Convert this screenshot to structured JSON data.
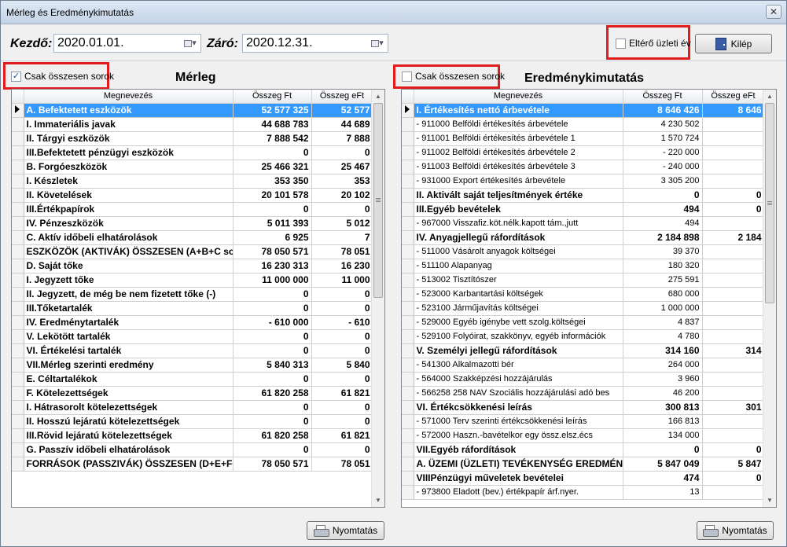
{
  "window": {
    "title": "Mérleg és Eredménykimutatás",
    "close_label": "✕"
  },
  "header": {
    "from_label": "Kezdő:",
    "from_value": "2020.01.01.",
    "to_label": "Záró:",
    "to_value": "2020.12.31.",
    "fiscal_year_label": "Eltérő üzleti év",
    "fiscal_year_checked": false,
    "exit_label": "Kilép"
  },
  "balance": {
    "title": "Mérleg",
    "only_totals_label": "Csak összesen sorok",
    "only_totals_checked": true,
    "columns": [
      "Megnevezés",
      "Összeg Ft",
      "Összeg eFt"
    ],
    "rows": [
      {
        "name": "A.  Befektetett eszközök",
        "ft": "52 577 325",
        "eft": "52 577",
        "selected": true
      },
      {
        "name": "I.   Immateriális javak",
        "ft": "44 688 783",
        "eft": "44 689"
      },
      {
        "name": "II.  Tárgyi eszközök",
        "ft": "7 888 542",
        "eft": "7 888"
      },
      {
        "name": "III.Befektetett pénzügyi eszközök",
        "ft": "0",
        "eft": "0"
      },
      {
        "name": "B.  Forgóeszközök",
        "ft": "25 466 321",
        "eft": "25 467"
      },
      {
        "name": "I.   Készletek",
        "ft": "353 350",
        "eft": "353"
      },
      {
        "name": "II.  Követelések",
        "ft": "20 101 578",
        "eft": "20 102"
      },
      {
        "name": "III.Értékpapírok",
        "ft": "0",
        "eft": "0"
      },
      {
        "name": "IV.  Pénzeszközök",
        "ft": "5 011 393",
        "eft": "5 012"
      },
      {
        "name": "C.  Aktív időbeli elhatárolások",
        "ft": "6 925",
        "eft": "7"
      },
      {
        "name": "ESZKÖZÖK (AKTIVÁK) ÖSSZESEN (A+B+C sor)",
        "ft": "78 050 571",
        "eft": "78 051"
      },
      {
        "name": "D.  Saját tőke",
        "ft": "16 230 313",
        "eft": "16 230"
      },
      {
        "name": "I.  Jegyzett tőke",
        "ft": "11 000 000",
        "eft": "11 000"
      },
      {
        "name": "II.  Jegyzett, de még be nem fizetett tőke (-)",
        "ft": "0",
        "eft": "0"
      },
      {
        "name": "III.Tőketartalék",
        "ft": "0",
        "eft": "0"
      },
      {
        "name": "IV.  Eredménytartalék",
        "ft": "-  610 000",
        "eft": "-    610"
      },
      {
        "name": "V.   Lekötött tartalék",
        "ft": "0",
        "eft": "0"
      },
      {
        "name": "VI.  Értékelési tartalék",
        "ft": "0",
        "eft": "0"
      },
      {
        "name": "VII.Mérleg szerinti eredmény",
        "ft": "5 840 313",
        "eft": "5 840"
      },
      {
        "name": "E.   Céltartalékok",
        "ft": "0",
        "eft": "0"
      },
      {
        "name": "F.   Kötelezettségek",
        "ft": "61 820 258",
        "eft": "61 821"
      },
      {
        "name": "I.  Hátrasorolt kötelezettségek",
        "ft": "0",
        "eft": "0"
      },
      {
        "name": "II.  Hosszú lejáratú kötelezettségek",
        "ft": "0",
        "eft": "0"
      },
      {
        "name": "III.Rövid lejáratú kötelezettségek",
        "ft": "61 820 258",
        "eft": "61 821"
      },
      {
        "name": "G.  Passzív időbeli elhatárolások",
        "ft": "0",
        "eft": "0"
      },
      {
        "name": "FORRÁSOK (PASSZIVÁK) ÖSSZESEN (D+E+F+G)",
        "ft": "78 050 571",
        "eft": "78 051"
      }
    ],
    "print_label": "Nyomtatás"
  },
  "income": {
    "title": "Eredménykimutatás",
    "only_totals_label": "Csak összesen sorok",
    "only_totals_checked": false,
    "columns": [
      "Megnevezés",
      "Összeg Ft",
      "Összeg eFt"
    ],
    "rows": [
      {
        "name": "I.  Értékesítés nettó árbevétele",
        "ft": "8 646 426",
        "eft": "8 646",
        "bold": true,
        "selected": true
      },
      {
        "name": "- 911000 Belföldi értékesítés árbevétele",
        "ft": "4 230 502",
        "eft": ""
      },
      {
        "name": "- 911001 Belföldi értékesítés árbevétele 1",
        "ft": "1 570 724",
        "eft": ""
      },
      {
        "name": "- 911002 Belföldi értékesítés árbevétele 2",
        "ft": "-  220 000",
        "eft": ""
      },
      {
        "name": "- 911003 Belföldi értékesítés árbevétele 3",
        "ft": "-  240 000",
        "eft": ""
      },
      {
        "name": "- 931000 Export értékesítés árbevétele",
        "ft": "3 305 200",
        "eft": ""
      },
      {
        "name": "II. Aktivált saját teljesítmények értéke",
        "ft": "0",
        "eft": "0",
        "bold": true
      },
      {
        "name": "III.Egyéb bevételek",
        "ft": "494",
        "eft": "0",
        "bold": true
      },
      {
        "name": "- 967000 Visszafiz.köt.nélk.kapott tám.,jutt",
        "ft": "494",
        "eft": ""
      },
      {
        "name": "IV. Anyagjellegű ráfordítások",
        "ft": "2 184 898",
        "eft": "2 184",
        "bold": true
      },
      {
        "name": "- 511000 Vásárolt anyagok költségei",
        "ft": "39 370",
        "eft": ""
      },
      {
        "name": "- 511100 Alapanyag",
        "ft": "180 320",
        "eft": ""
      },
      {
        "name": "- 513002 Tisztítószer",
        "ft": "275 591",
        "eft": ""
      },
      {
        "name": "- 523000 Karbantartási költségek",
        "ft": "680 000",
        "eft": ""
      },
      {
        "name": "- 523100 Járműjavítás költségei",
        "ft": "1 000 000",
        "eft": ""
      },
      {
        "name": "- 529000 Egyéb igénybe vett szolg.költségei",
        "ft": "4 837",
        "eft": ""
      },
      {
        "name": "- 529100 Folyóirat, szakkönyv, egyéb információk",
        "ft": "4 780",
        "eft": ""
      },
      {
        "name": "V.   Személyi jellegű ráfordítások",
        "ft": "314 160",
        "eft": "314",
        "bold": true
      },
      {
        "name": "- 541300 Alkalmazotti bér",
        "ft": "264 000",
        "eft": ""
      },
      {
        "name": "- 564000 Szakképzési hozzájárulás",
        "ft": "3 960",
        "eft": ""
      },
      {
        "name": "- 566258 258 NAV Szociális hozzájárulási adó bes",
        "ft": "46 200",
        "eft": ""
      },
      {
        "name": "VI. Értékcsökkenési leírás",
        "ft": "300 813",
        "eft": "301",
        "bold": true
      },
      {
        "name": "- 571000 Terv szerinti értékcsökkenési leírás",
        "ft": "166 813",
        "eft": ""
      },
      {
        "name": "- 572000 Haszn.-bavételkor egy össz.elsz.écs",
        "ft": "134 000",
        "eft": ""
      },
      {
        "name": "VII.Egyéb ráfordítások",
        "ft": "0",
        "eft": "0",
        "bold": true
      },
      {
        "name": "A.  ÜZEMI (ÜZLETI) TEVÉKENYSÉG EREDMÉNYE",
        "ft": "5 847 049",
        "eft": "5 847",
        "bold": true
      },
      {
        "name": "VIIIPénzügyi műveletek bevételei",
        "ft": "474",
        "eft": "0",
        "bold": true
      },
      {
        "name": "- 973800 Eladott (bev.) értékpapír árf.nyer.",
        "ft": "13",
        "eft": ""
      }
    ],
    "print_label": "Nyomtatás"
  },
  "icons": {
    "calendar": "calendar-icon",
    "dropdown": "▾",
    "row_pointer": "row-pointer-icon",
    "scroll_up": "▲",
    "scroll_down": "▼",
    "check_mark": "✓"
  }
}
